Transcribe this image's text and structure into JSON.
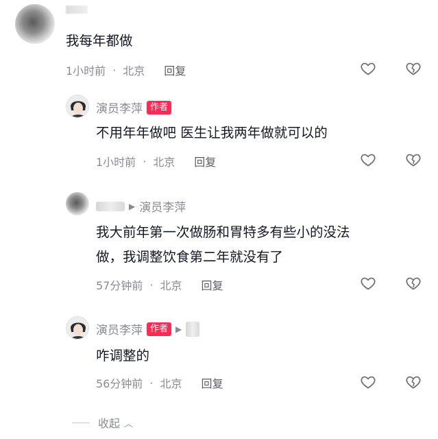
{
  "comments": [
    {
      "text": "我每年都做",
      "time": "1小时前",
      "location": "北京",
      "reply_label": "回复"
    },
    {
      "username": "演员李萍",
      "badge": "作者",
      "text": "不用年年做吧 医生让我两年做就可以的",
      "time": "1小时前",
      "location": "北京",
      "reply_label": "回复"
    },
    {
      "reply_to": "演员李萍",
      "text_line1": "我大前年第一次做肠和胃特多有些小的没法",
      "text_line2": "做，我调整饮食第二年就没有了",
      "time": "57分钟前",
      "location": "北京",
      "reply_label": "回复"
    },
    {
      "username": "演员李萍",
      "badge": "作者",
      "text": "咋调整的",
      "time": "56分钟前",
      "location": "北京",
      "reply_label": "回复"
    }
  ],
  "separator": "·",
  "collapse_label": "收起",
  "collapse_icon": "chevron-up-icon",
  "icons": {
    "like": "heart-outline-icon",
    "dislike": "broken-heart-icon"
  },
  "colors": {
    "badge": "#fe2c55",
    "meta": "#8a8b91",
    "text": "#161823"
  }
}
